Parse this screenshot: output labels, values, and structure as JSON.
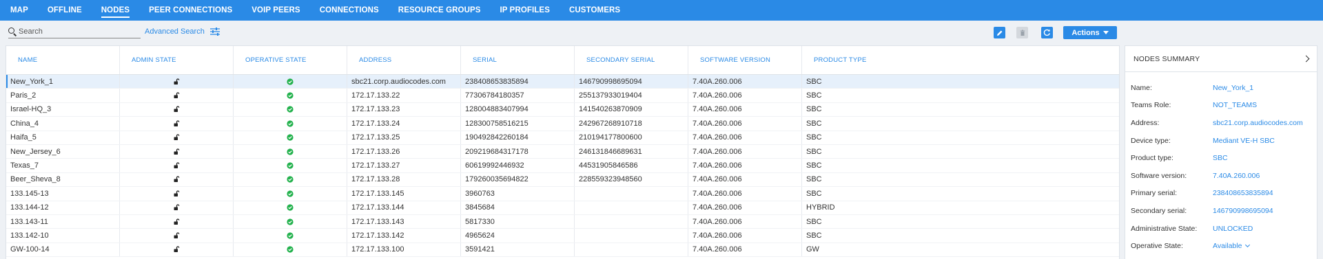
{
  "nav": {
    "tabs": [
      "MAP",
      "OFFLINE",
      "NODES",
      "PEER CONNECTIONS",
      "VOIP PEERS",
      "CONNECTIONS",
      "RESOURCE GROUPS",
      "IP PROFILES",
      "CUSTOMERS"
    ],
    "active": "NODES"
  },
  "toolbar": {
    "search_placeholder": "Search",
    "advanced_search_label": "Advanced Search",
    "actions_label": "Actions"
  },
  "table": {
    "columns": [
      "NAME",
      "ADMIN STATE",
      "OPERATIVE STATE",
      "ADDRESS",
      "SERIAL",
      "SECONDARY SERIAL",
      "SOFTWARE VERSION",
      "PRODUCT TYPE"
    ],
    "rows": [
      {
        "name": "New_York_1",
        "address": "sbc21.corp.audiocodes.com",
        "serial": "238408653835894",
        "secondary_serial": "146790998695094",
        "software_version": "7.40A.260.006",
        "product_type": "SBC"
      },
      {
        "name": "Paris_2",
        "address": "172.17.133.22",
        "serial": "77306784180357",
        "secondary_serial": "255137933019404",
        "software_version": "7.40A.260.006",
        "product_type": "SBC"
      },
      {
        "name": "Israel-HQ_3",
        "address": "172.17.133.23",
        "serial": "128004883407994",
        "secondary_serial": "141540263870909",
        "software_version": "7.40A.260.006",
        "product_type": "SBC"
      },
      {
        "name": "China_4",
        "address": "172.17.133.24",
        "serial": "128300758516215",
        "secondary_serial": "242967268910718",
        "software_version": "7.40A.260.006",
        "product_type": "SBC"
      },
      {
        "name": "Haifa_5",
        "address": "172.17.133.25",
        "serial": "190492842260184",
        "secondary_serial": "210194177800600",
        "software_version": "7.40A.260.006",
        "product_type": "SBC"
      },
      {
        "name": "New_Jersey_6",
        "address": "172.17.133.26",
        "serial": "209219684317178",
        "secondary_serial": "246131846689631",
        "software_version": "7.40A.260.006",
        "product_type": "SBC"
      },
      {
        "name": "Texas_7",
        "address": "172.17.133.27",
        "serial": "60619992446932",
        "secondary_serial": "44531905846586",
        "software_version": "7.40A.260.006",
        "product_type": "SBC"
      },
      {
        "name": "Beer_Sheva_8",
        "address": "172.17.133.28",
        "serial": "179260035694822",
        "secondary_serial": "228559323948560",
        "software_version": "7.40A.260.006",
        "product_type": "SBC"
      },
      {
        "name": "133.145-13",
        "address": "172.17.133.145",
        "serial": "3960763",
        "secondary_serial": "",
        "software_version": "7.40A.260.006",
        "product_type": "SBC"
      },
      {
        "name": "133.144-12",
        "address": "172.17.133.144",
        "serial": "3845684",
        "secondary_serial": "",
        "software_version": "7.40A.260.006",
        "product_type": "HYBRID"
      },
      {
        "name": "133.143-11",
        "address": "172.17.133.143",
        "serial": "5817330",
        "secondary_serial": "",
        "software_version": "7.40A.260.006",
        "product_type": "SBC"
      },
      {
        "name": "133.142-10",
        "address": "172.17.133.142",
        "serial": "4965624",
        "secondary_serial": "",
        "software_version": "7.40A.260.006",
        "product_type": "SBC"
      },
      {
        "name": "GW-100-14",
        "address": "172.17.133.100",
        "serial": "3591421",
        "secondary_serial": "",
        "software_version": "7.40A.260.006",
        "product_type": "GW"
      }
    ]
  },
  "summary": {
    "title": "NODES SUMMARY",
    "fields": [
      {
        "label": "Name:",
        "value": "New_York_1"
      },
      {
        "label": "Teams Role:",
        "value": "NOT_TEAMS"
      },
      {
        "label": "Address:",
        "value": "sbc21.corp.audiocodes.com"
      },
      {
        "label": "Device type:",
        "value": "Mediant VE-H SBC"
      },
      {
        "label": "Product type:",
        "value": "SBC"
      },
      {
        "label": "Software version:",
        "value": "7.40A.260.006"
      },
      {
        "label": "Primary serial:",
        "value": "238408653835894"
      },
      {
        "label": "Secondary serial:",
        "value": "146790998695094"
      },
      {
        "label": "Administrative State:",
        "value": "UNLOCKED"
      },
      {
        "label": "Operative State:",
        "value": "Available"
      }
    ]
  },
  "colors": {
    "accent": "#2a8ae6",
    "status_ok": "#22b14c",
    "selected_row": "#e6f0fb"
  },
  "icons": {
    "admin_state": "unlock-icon",
    "operative_state": "check-circle-icon",
    "toolbar": [
      "edit-icon",
      "delete-icon",
      "refresh-icon",
      "sliders-icon"
    ]
  }
}
